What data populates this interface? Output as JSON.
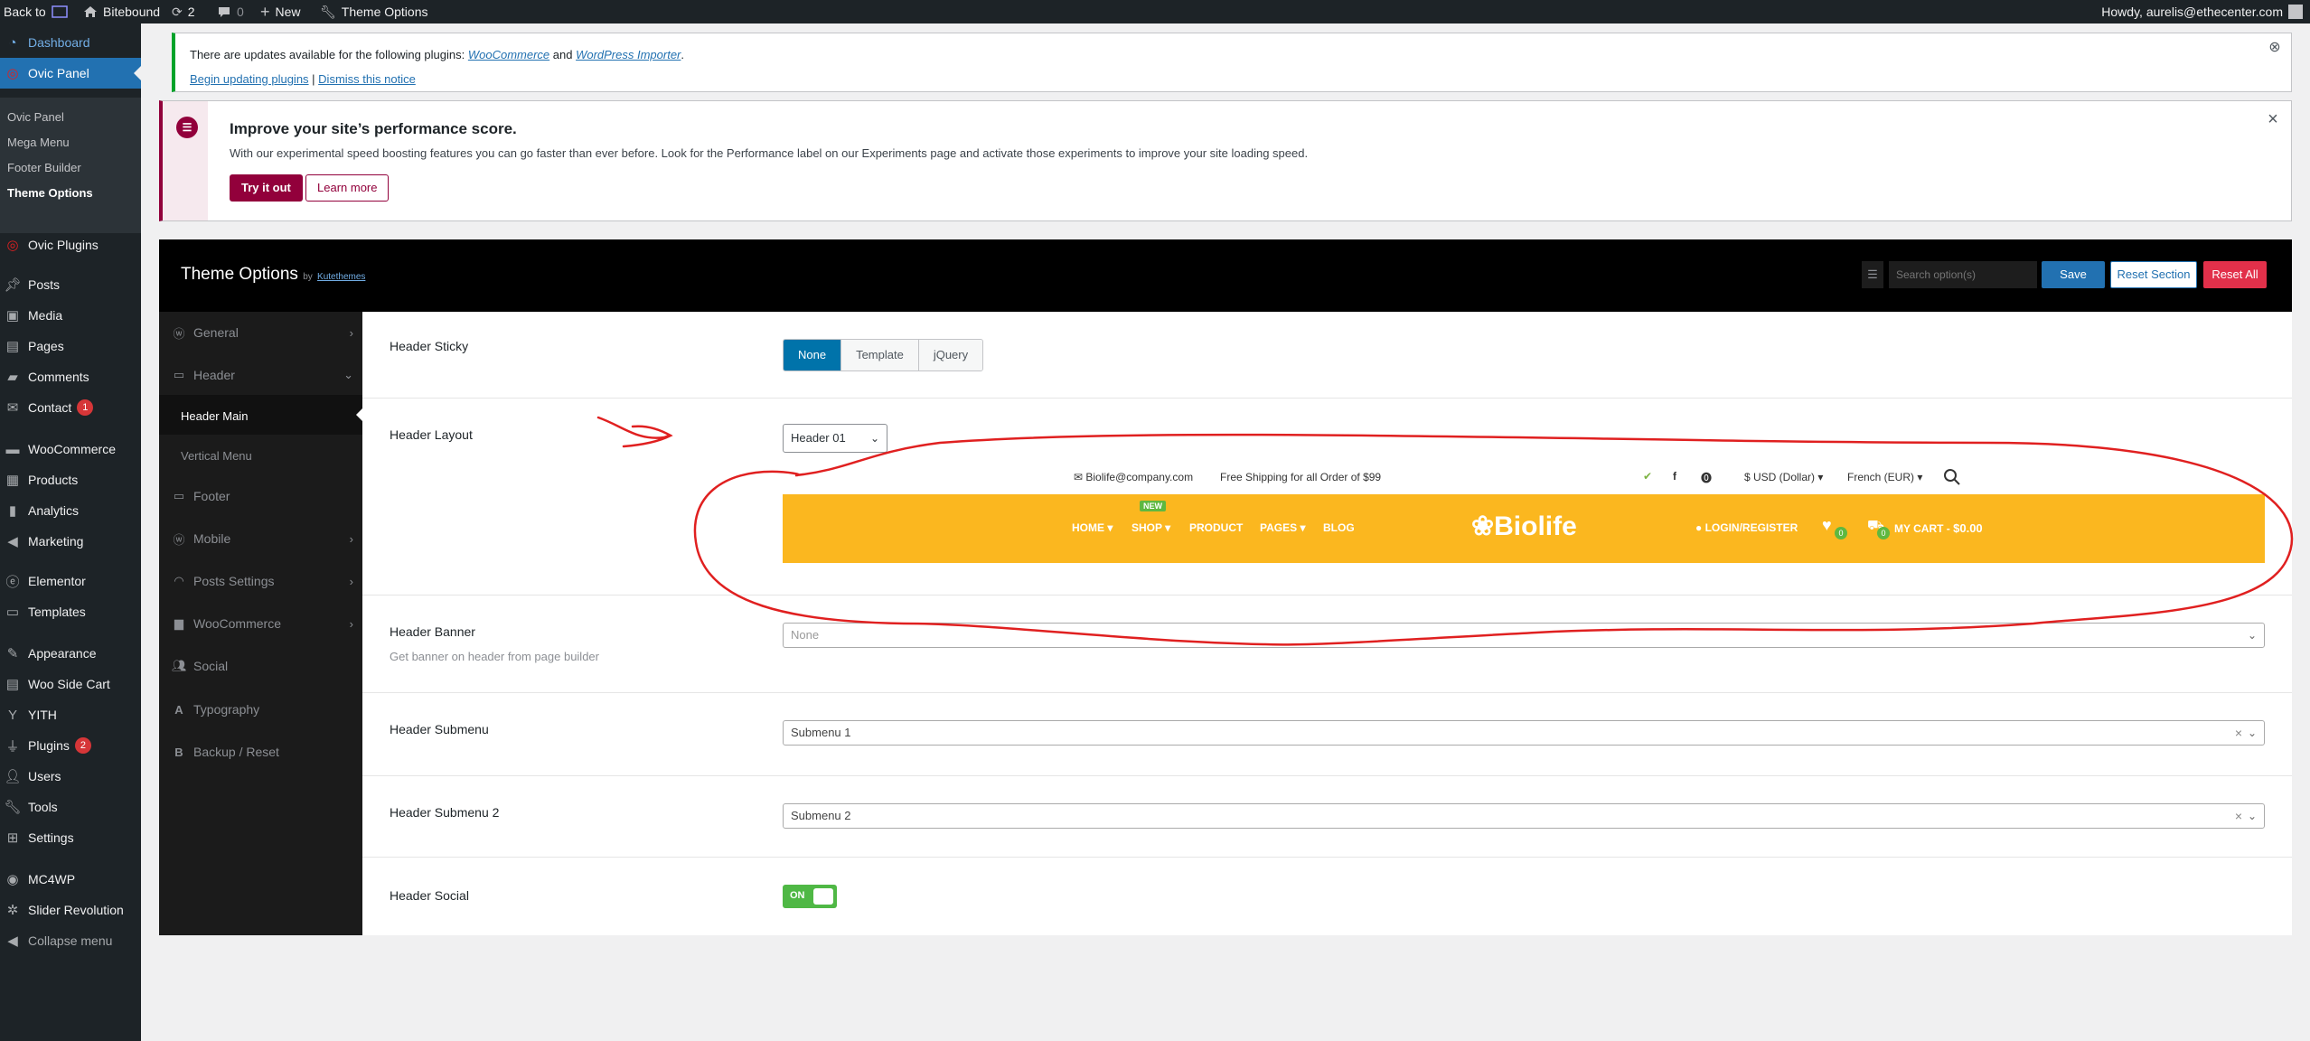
{
  "adminbar": {
    "back_to": "Back to",
    "site_name": "Bitebound",
    "updates_count": "2",
    "comments_count": "0",
    "new_label": "New",
    "theme_options": "Theme Options",
    "howdy": "Howdy, aurelis@ethecenter.com"
  },
  "sidebar": {
    "dashboard": "Dashboard",
    "ovic_panel": "Ovic Panel",
    "submenu": [
      "Ovic Panel",
      "Mega Menu",
      "Footer Builder",
      "Theme Options"
    ],
    "items": [
      {
        "label": "Ovic Plugins",
        "icon": "ovic-icon"
      },
      {
        "label": "Posts",
        "icon": "pin-icon"
      },
      {
        "label": "Media",
        "icon": "media-icon"
      },
      {
        "label": "Pages",
        "icon": "pages-icon"
      },
      {
        "label": "Comments",
        "icon": "comment-icon"
      },
      {
        "label": "Contact",
        "icon": "mail-icon",
        "badge": "1"
      },
      {
        "label": "WooCommerce",
        "icon": "woo-icon"
      },
      {
        "label": "Products",
        "icon": "products-icon"
      },
      {
        "label": "Analytics",
        "icon": "analytics-icon"
      },
      {
        "label": "Marketing",
        "icon": "megaphone-icon"
      },
      {
        "label": "Elementor",
        "icon": "elementor-icon"
      },
      {
        "label": "Templates",
        "icon": "folder-icon"
      },
      {
        "label": "Appearance",
        "icon": "brush-icon"
      },
      {
        "label": "Woo Side Cart",
        "icon": "cart-icon"
      },
      {
        "label": "YITH",
        "icon": "yith-icon"
      },
      {
        "label": "Plugins",
        "icon": "plugin-icon",
        "badge": "2"
      },
      {
        "label": "Users",
        "icon": "users-icon"
      },
      {
        "label": "Tools",
        "icon": "wrench-icon"
      },
      {
        "label": "Settings",
        "icon": "settings-icon"
      },
      {
        "label": "MC4WP",
        "icon": "mc4wp-icon"
      },
      {
        "label": "Slider Revolution",
        "icon": "slider-icon"
      },
      {
        "label": "Collapse menu",
        "icon": "collapse-icon"
      }
    ]
  },
  "notice_updates": {
    "text_prefix": "There are updates available for the following plugins: ",
    "plugin1": "WooCommerce",
    "and": " and ",
    "plugin2": "WordPress Importer",
    "period": ".",
    "begin_link": "Begin updating plugins",
    "sep": " | ",
    "dismiss_link": "Dismiss this notice"
  },
  "notice_performance": {
    "title": "Improve your site’s performance score.",
    "body": "With our experimental speed boosting features you can go faster than ever before. Look for the Performance label on our Experiments page and activate those experiments to improve your site loading speed.",
    "try_btn": "Try it out",
    "learn_btn": "Learn more"
  },
  "theme_options": {
    "title": "Theme Options",
    "by": "by",
    "author": "Kutethemes",
    "search_placeholder": "Search option(s)",
    "save": "Save",
    "reset_section": "Reset Section",
    "reset_all": "Reset All",
    "nav": [
      {
        "label": "General",
        "icon": "wordpress-icon"
      },
      {
        "label": "Header",
        "icon": "folder-open-icon"
      },
      {
        "label": "Header Main"
      },
      {
        "label": "Vertical Menu"
      },
      {
        "label": "Footer",
        "icon": "folder-icon"
      },
      {
        "label": "Mobile",
        "icon": "wordpress-icon"
      },
      {
        "label": "Posts Settings",
        "icon": "rss-icon"
      },
      {
        "label": "WooCommerce",
        "icon": "bag-icon"
      },
      {
        "label": "Social",
        "icon": "users-icon"
      },
      {
        "label": "Typography",
        "icon": "typography-icon"
      },
      {
        "label": "Backup / Reset",
        "icon": "backup-icon"
      }
    ]
  },
  "fields": {
    "sticky": {
      "label": "Header Sticky",
      "options": [
        "None",
        "Template",
        "jQuery"
      ],
      "selected": "None"
    },
    "layout": {
      "label": "Header Layout",
      "value": "Header 01"
    },
    "banner": {
      "label": "Header Banner",
      "desc": "Get banner on header from page builder",
      "value": "None"
    },
    "submenu": {
      "label": "Header Submenu",
      "value": "Submenu 1"
    },
    "submenu2": {
      "label": "Header Submenu 2",
      "value": "Submenu 2"
    },
    "social": {
      "label": "Header Social",
      "value": "ON"
    }
  },
  "preview": {
    "email": "Biolife@company.com",
    "shipping": "Free Shipping for all Order of $99",
    "currency": "$ USD (Dollar)",
    "language": "French (EUR)",
    "nav": [
      "HOME",
      "SHOP",
      "PRODUCT",
      "PAGES",
      "BLOG"
    ],
    "new_badge": "NEW",
    "logo": "Biolife",
    "login": "LOGIN/REGISTER",
    "wish_count": "0",
    "cart_count": "0",
    "cart_label": "MY CART",
    "cart_sep": " - ",
    "cart_total": "$0.00"
  },
  "colors": {
    "admin_blue": "#2271b1",
    "preview_bar": "#fbb71f",
    "annotation": "#e02020",
    "reset_all": "#e2304a"
  }
}
